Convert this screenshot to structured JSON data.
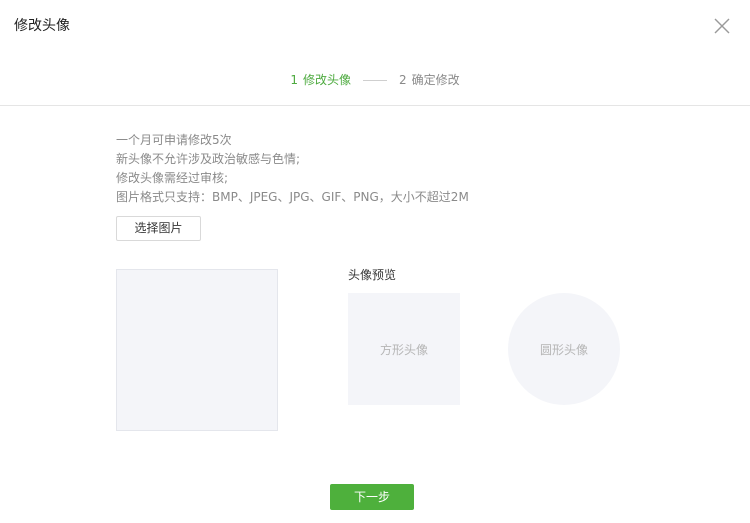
{
  "dialog": {
    "title": "修改头像",
    "close_icon": "close-icon"
  },
  "steps": [
    {
      "number": "1",
      "label": "修改头像",
      "active": true
    },
    {
      "number": "2",
      "label": "确定修改",
      "active": false
    }
  ],
  "rules": [
    "一个月可申请修改5次",
    "新头像不允许涉及政治敏感与色情;",
    "修改头像需经过审核;",
    "图片格式只支持：BMP、JPEG、JPG、GIF、PNG，大小不超过2M"
  ],
  "choose_button": "选择图片",
  "preview": {
    "label": "头像预览",
    "square": "方形头像",
    "circle": "圆形头像"
  },
  "next_button": "下一步",
  "colors": {
    "accent": "#4eb03c",
    "active_step": "#4daa3f",
    "placeholder_bg": "#f4f5f9"
  }
}
